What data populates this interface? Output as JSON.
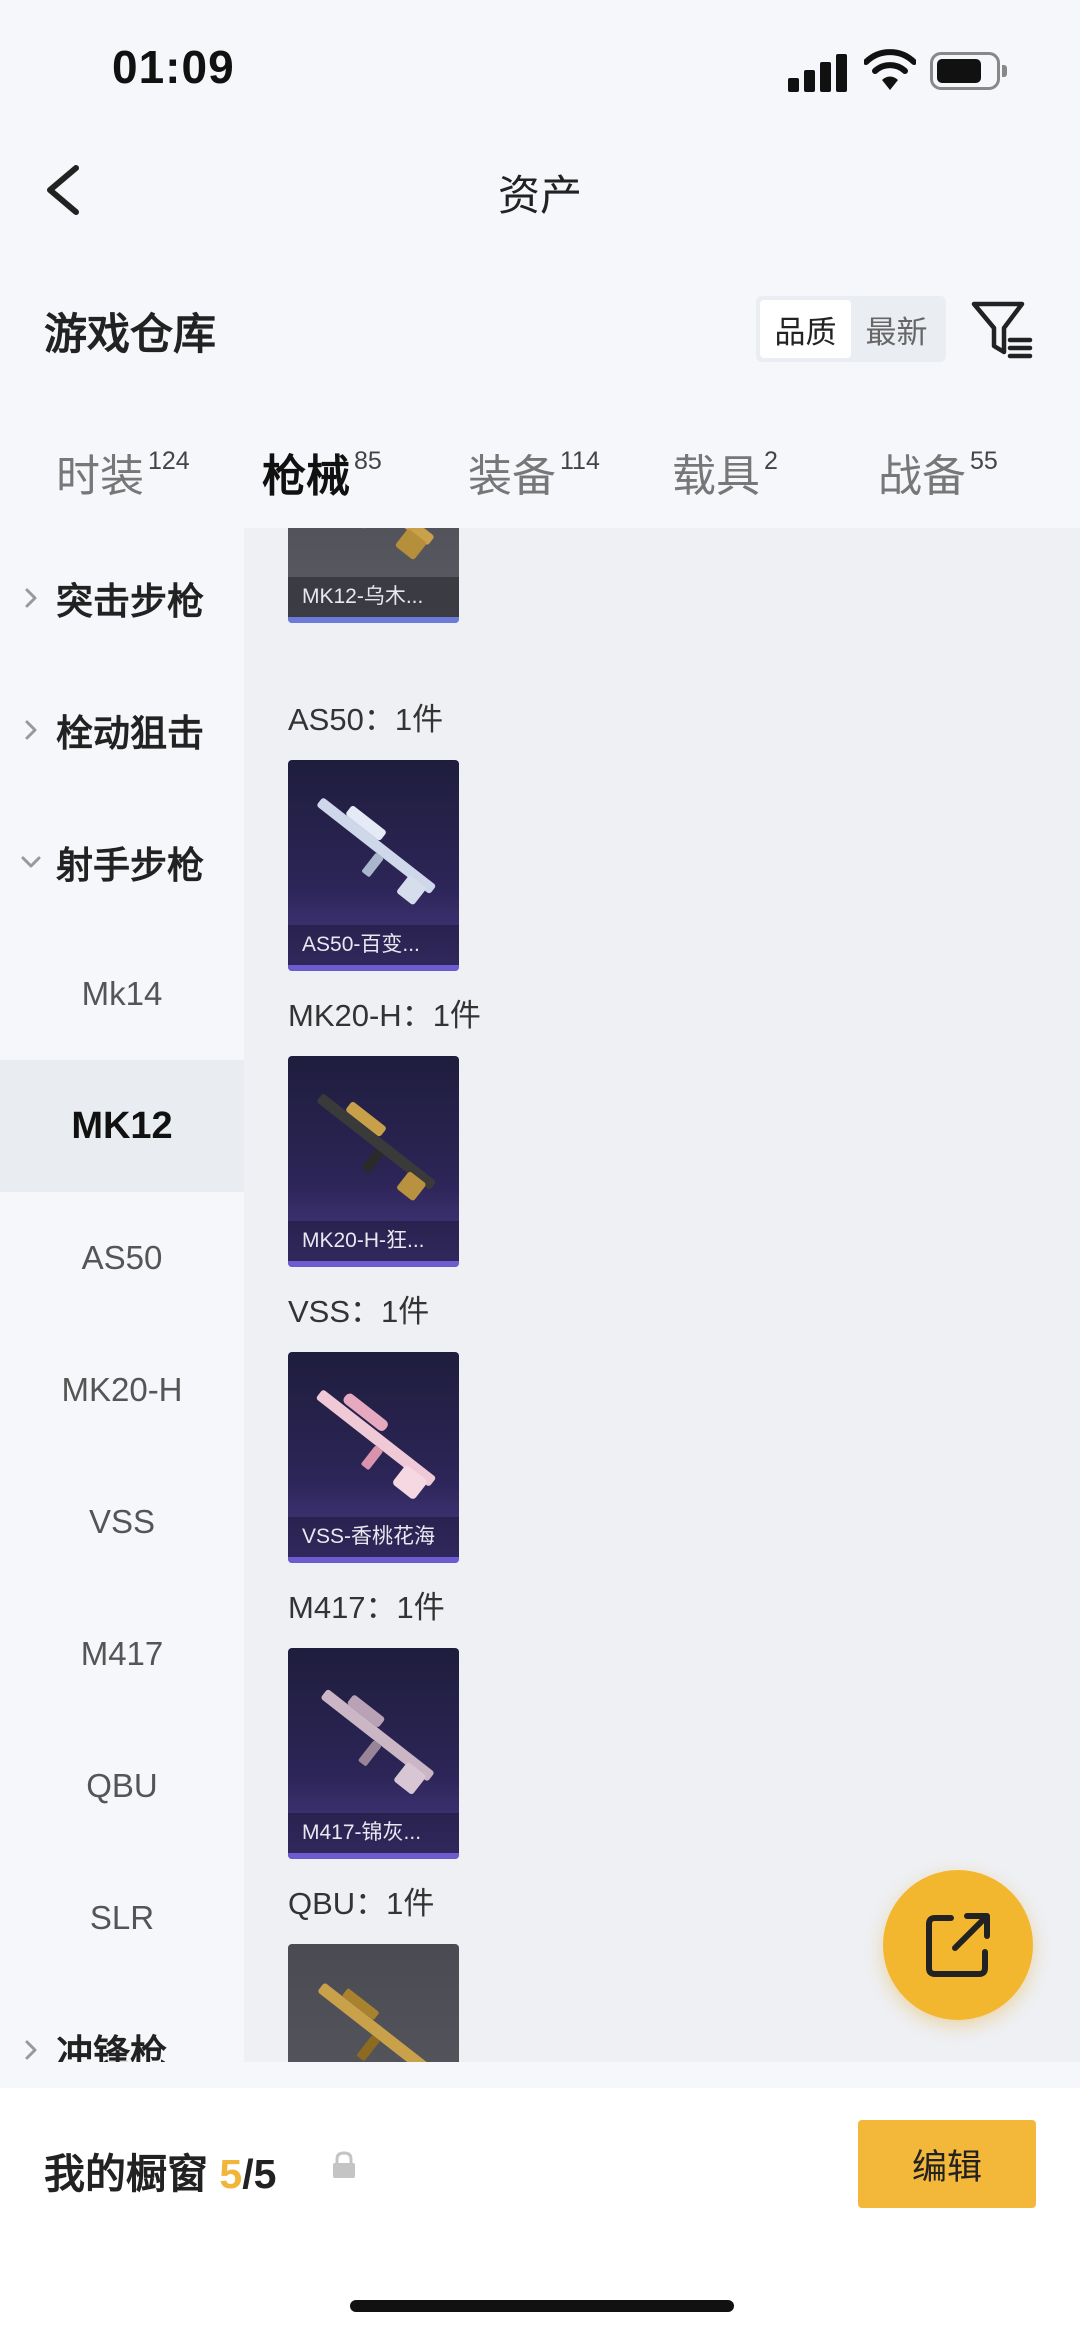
{
  "status_bar": {
    "time": "01:09"
  },
  "nav": {
    "title": "资产"
  },
  "warehouse": {
    "title": "游戏仓库",
    "sort_options": [
      "品质",
      "最新"
    ],
    "sort_selected": "品质"
  },
  "tabs": [
    {
      "label": "时装",
      "count": "124",
      "active": false
    },
    {
      "label": "枪械",
      "count": "85",
      "active": true
    },
    {
      "label": "装备",
      "count": "114",
      "active": false
    },
    {
      "label": "载具",
      "count": "2",
      "active": false
    },
    {
      "label": "战备",
      "count": "55",
      "active": false
    }
  ],
  "sidebar": {
    "groups": {
      "assault": "突击步枪",
      "bolt": "栓动狙击",
      "marksman": "射手步枪",
      "smg": "冲锋枪"
    },
    "marksman_items": [
      "Mk14",
      "MK12",
      "AS50",
      "MK20-H",
      "VSS",
      "M417",
      "QBU",
      "SLR"
    ],
    "selected": "MK12"
  },
  "content": {
    "items": [
      {
        "card_name": "MK12-乌木...",
        "count_label": "AS50：1件"
      },
      {
        "card_name": "AS50-百变...",
        "count_label": "MK20-H：1件"
      },
      {
        "card_name": "MK20-H-狂...",
        "count_label": "VSS：1件"
      },
      {
        "card_name": "VSS-香桃花海",
        "count_label": "M417：1件"
      },
      {
        "card_name": "M417-锦灰...",
        "count_label": "QBU：1件"
      }
    ]
  },
  "showcase": {
    "label": "我的橱窗",
    "count": "5",
    "total": "/5",
    "edit_label": "编辑"
  },
  "colors": {
    "accent": "#f3b73a",
    "card_purple": "#2c2557",
    "card_gold": "#5a5b62",
    "background": "#f5f7fa"
  },
  "icons": [
    "back-arrow-icon",
    "filter-icon",
    "chevron-right-icon",
    "chevron-down-icon",
    "share-icon",
    "lock-icon"
  ]
}
